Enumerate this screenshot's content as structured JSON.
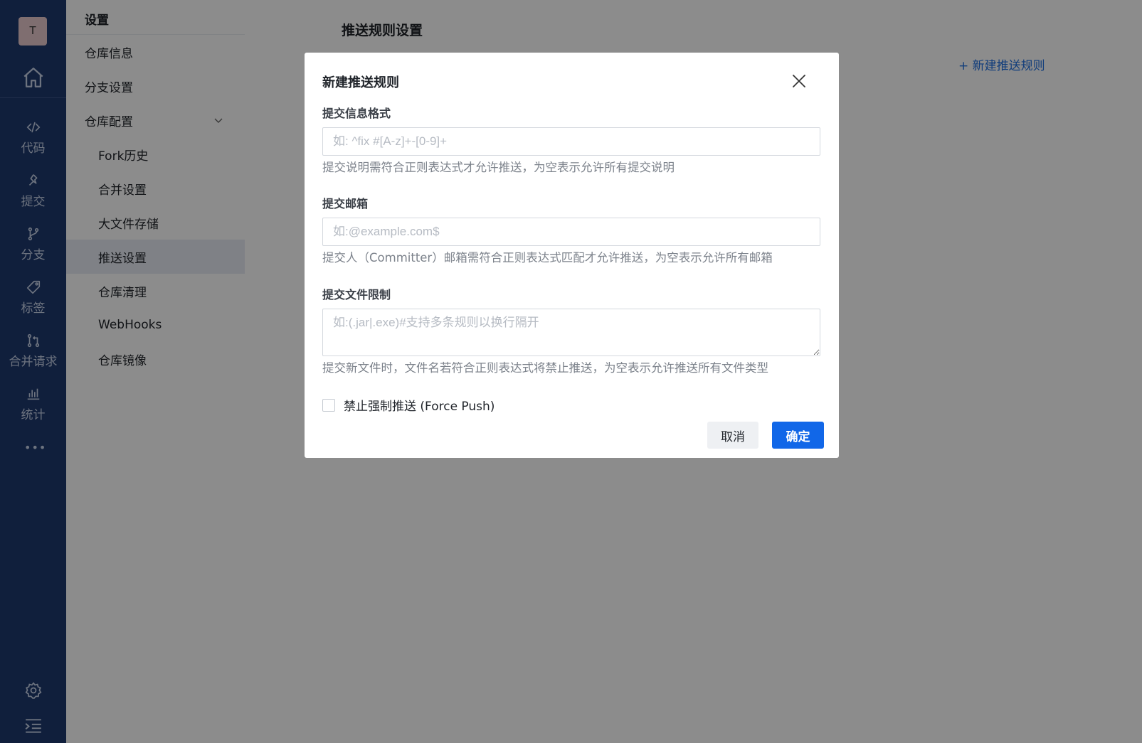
{
  "rail": {
    "avatar_letter": "T",
    "items": [
      {
        "label": "代码",
        "icon": "code-icon"
      },
      {
        "label": "提交",
        "icon": "pin-icon"
      },
      {
        "label": "分支",
        "icon": "branch-icon"
      },
      {
        "label": "标签",
        "icon": "tag-icon"
      },
      {
        "label": "合并请求",
        "icon": "merge-request-icon"
      },
      {
        "label": "统计",
        "icon": "bar-chart-icon"
      }
    ],
    "more": "•••"
  },
  "sidebar": {
    "title": "设置",
    "items": [
      {
        "label": "仓库信息"
      },
      {
        "label": "分支设置"
      },
      {
        "label": "仓库配置"
      },
      {
        "label": "Fork历史"
      },
      {
        "label": "合并设置"
      },
      {
        "label": "大文件存储"
      },
      {
        "label": "推送设置"
      },
      {
        "label": "仓库清理"
      },
      {
        "label": "WebHooks"
      },
      {
        "label": "仓库镜像"
      }
    ]
  },
  "main": {
    "title": "推送规则设置",
    "new_rule_link": "+ 新建推送规则"
  },
  "modal": {
    "title": "新建推送规则",
    "commit_message": {
      "label": "提交信息格式",
      "placeholder": "如: ^fix #[A-z]+-[0-9]+",
      "value": "",
      "hint": "提交说明需符合正则表达式才允许推送，为空表示允许所有提交说明"
    },
    "commit_email": {
      "label": "提交邮箱",
      "placeholder": "如:@example.com$",
      "value": "",
      "hint": "提交人（Committer）邮箱需符合正则表达式匹配才允许推送，为空表示允许所有邮箱"
    },
    "file_limit": {
      "label": "提交文件限制",
      "placeholder": "如:(.jar|.exe)#支持多条规则以换行隔开",
      "value": "",
      "hint": "提交新文件时，文件名若符合正则表达式将禁止推送，为空表示允许推送所有文件类型"
    },
    "force_push": {
      "label": "禁止强制推送 (Force Push)",
      "checked": false
    },
    "cancel_label": "取消",
    "ok_label": "确定"
  },
  "colors": {
    "rail_bg": "#1e3a6e",
    "primary": "#1167e8",
    "link": "#1f6fe0"
  }
}
